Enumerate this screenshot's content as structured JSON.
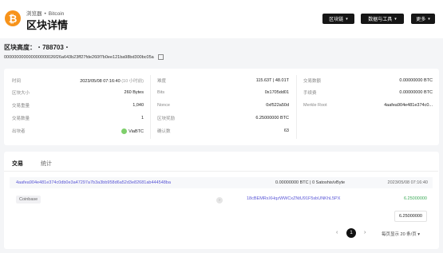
{
  "header": {
    "breadcrumb": [
      "浏览器",
      "Bitcoin"
    ],
    "title": "区块详情",
    "logo_symbol": "₿",
    "nav": [
      "区块链",
      "数据与工具",
      "更多"
    ]
  },
  "block": {
    "height_label": "区块高度：",
    "height": "788703",
    "hash": "000000000000000000026f26a643b23ff27fde260f7b0ee121ba98bd300bc05a"
  },
  "details": {
    "col1": [
      {
        "label": "时间",
        "value": "2023/05/08 07:16:40",
        "extra": "(10 小时前)"
      },
      {
        "label": "区块大小",
        "value": "260 Bytes"
      },
      {
        "label": "交易重量",
        "value": "1,040"
      },
      {
        "label": "交易数量",
        "value": "1"
      },
      {
        "label": "出块者",
        "value": "ViaBTC"
      }
    ],
    "col2": [
      {
        "label": "难度",
        "value": "115.63T | 48.01T"
      },
      {
        "label": "Bits",
        "value": "0x1705dd01"
      },
      {
        "label": "Nonce",
        "value": "0xf522a50d"
      },
      {
        "label": "区块奖励",
        "value": "6.25000000 BTC"
      },
      {
        "label": "确认数",
        "value": "63"
      }
    ],
    "col3": [
      {
        "label": "交易数额",
        "value": "0.00000000 BTC"
      },
      {
        "label": "手续费",
        "value": "0.00000000 BTC"
      },
      {
        "label": "Merkle Root",
        "value": "4aafea904e481e374c0..."
      }
    ]
  },
  "tabs": [
    "交易",
    "统计"
  ],
  "transaction": {
    "txid": "4aafea904e481e374c0db0e3a47297a7b3a3bb958d6a52d3e82681ab444548ba",
    "amount_fee": "0.00000000 BTC | 0 Satoshis/vByte",
    "date": "2023/05/08 07:16:40",
    "input": "Coinbase",
    "output_address": "18cBEMRxXHqzWWCxZNtU91F5sbUNKhL5PX",
    "output_amount": "6.25000000",
    "total": "6.25000000"
  },
  "pagination": {
    "current_page": "1",
    "per_page": "每页显示 20 条/页"
  },
  "colors": {
    "accent": "#5a57d6",
    "btc_orange": "#f7931a",
    "positive": "#3daa58"
  }
}
